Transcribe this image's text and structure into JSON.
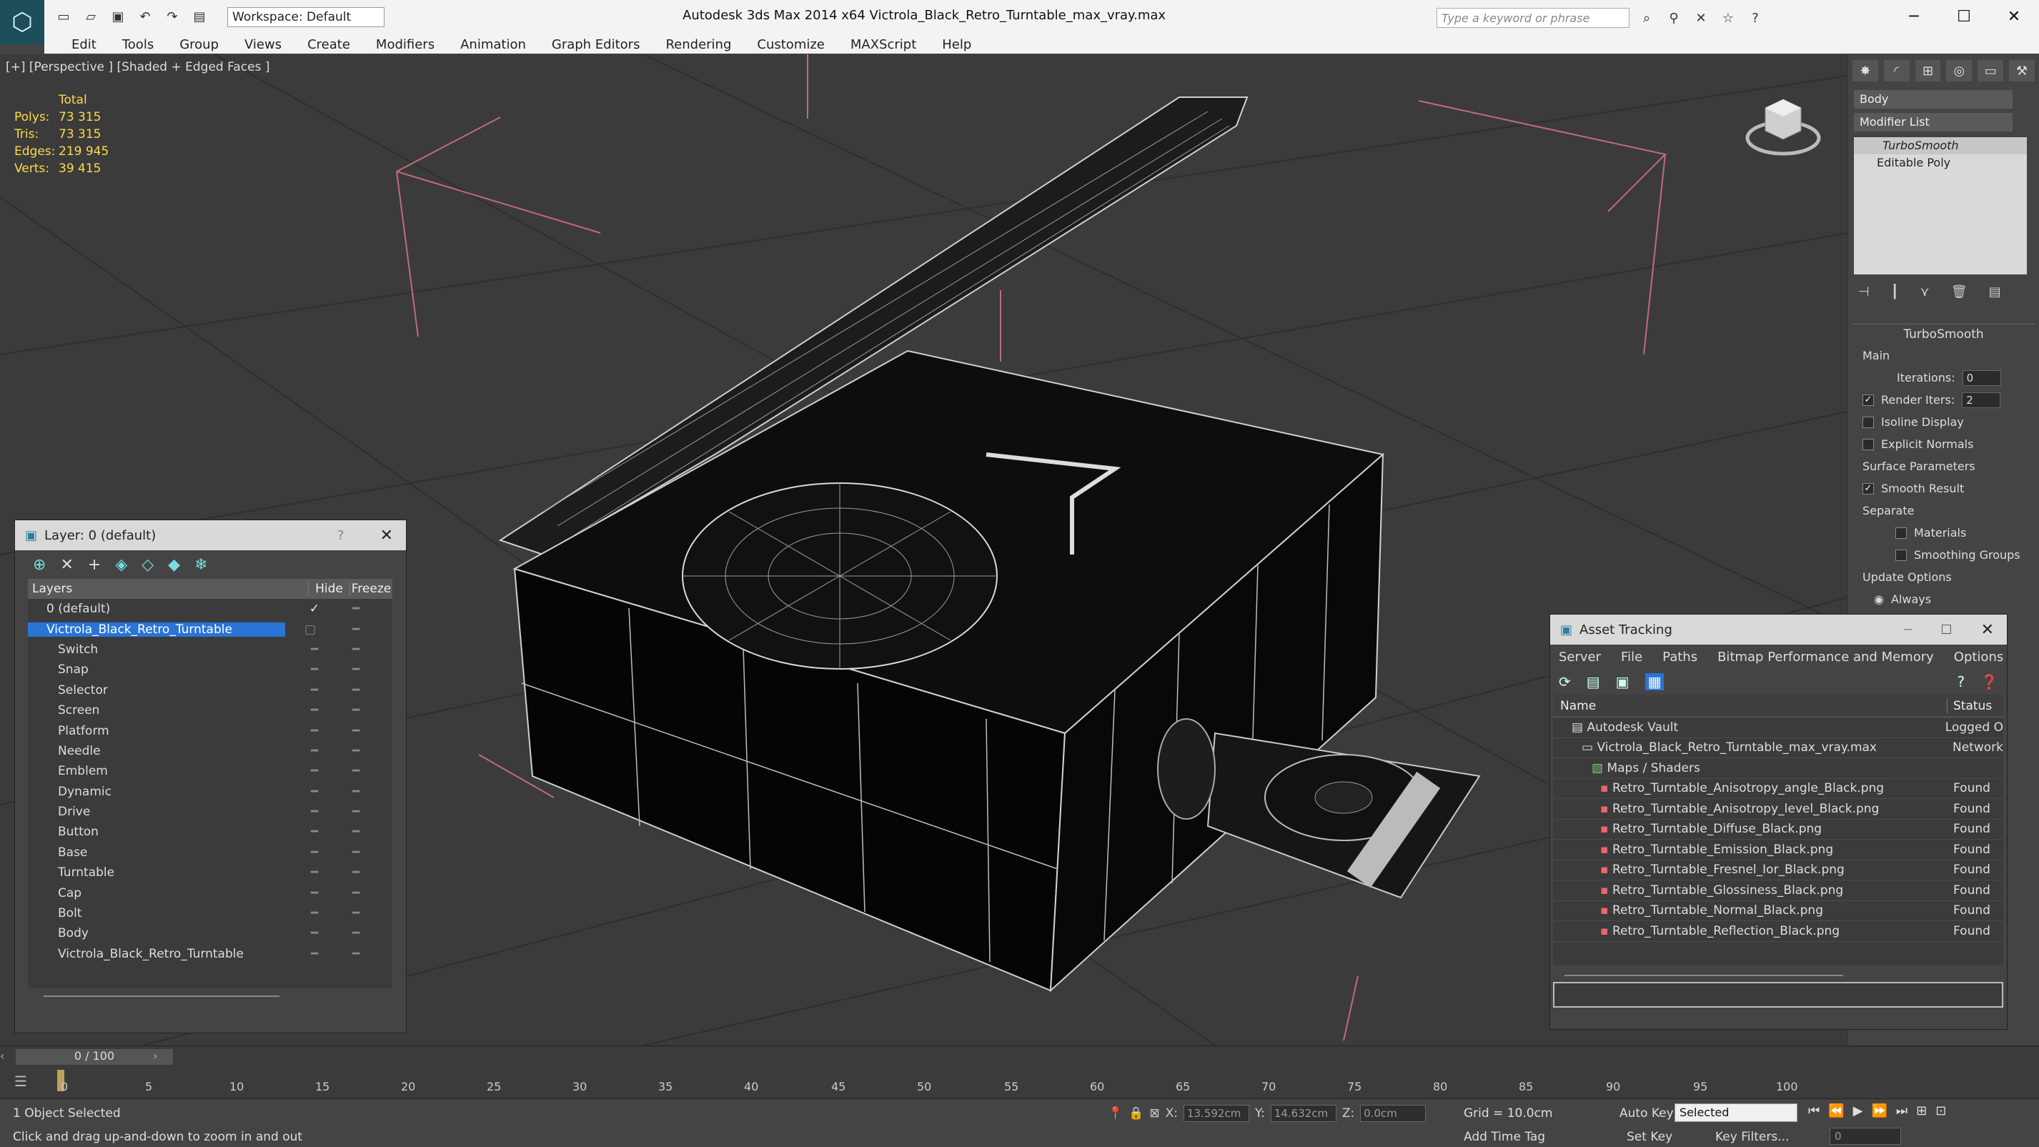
{
  "app": {
    "title": "Autodesk 3ds Max  2014 x64     Victrola_Black_Retro_Turntable_max_vray.max",
    "workspace": "Workspace: Default",
    "search_placeholder": "Type a keyword or phrase"
  },
  "menu": [
    "Edit",
    "Tools",
    "Group",
    "Views",
    "Create",
    "Modifiers",
    "Animation",
    "Graph Editors",
    "Rendering",
    "Customize",
    "MAXScript",
    "Help"
  ],
  "viewport": {
    "label": "[+] [Perspective ] [Shaded + Edged Faces ]",
    "stats": {
      "header": "Total",
      "rows": [
        {
          "label": "Polys:",
          "value": "73 315"
        },
        {
          "label": "Tris:",
          "value": "73 315"
        },
        {
          "label": "Edges:",
          "value": "219 945"
        },
        {
          "label": "Verts:",
          "value": "39 415"
        }
      ]
    }
  },
  "command_panel": {
    "object_name": "Body",
    "modifier_list": "Modifier List",
    "stack": [
      "TurboSmooth",
      "Editable Poly"
    ],
    "rollout_title": "TurboSmooth",
    "main_label": "Main",
    "iterations_label": "Iterations:",
    "iterations_value": "0",
    "render_iters_label": "Render Iters:",
    "render_iters_value": "2",
    "isoline": "Isoline Display",
    "explicit": "Explicit Normals",
    "surface_params": "Surface Parameters",
    "smooth_result": "Smooth Result",
    "separate": "Separate",
    "materials": "Materials",
    "smoothing_groups": "Smoothing Groups",
    "update_options": "Update Options",
    "always": "Always"
  },
  "layer_window": {
    "title": "Layer: 0 (default)",
    "help": "?",
    "col_layers": "Layers",
    "col_hide": "Hide",
    "col_freeze": "Freeze",
    "rows": [
      "0 (default)",
      "Victrola_Black_Retro_Turntable",
      "Switch",
      "Snap",
      "Selector",
      "Screen",
      "Platform",
      "Needle",
      "Emblem",
      "Dynamic",
      "Drive",
      "Button",
      "Base",
      "Turntable",
      "Cap",
      "Bolt",
      "Body",
      "Victrola_Black_Retro_Turntable"
    ]
  },
  "asset_window": {
    "title": "Asset Tracking",
    "menu": [
      "Server",
      "File",
      "Paths",
      "Bitmap Performance and Memory",
      "Options"
    ],
    "col_name": "Name",
    "col_status": "Status",
    "rows": [
      {
        "name": "Autodesk Vault",
        "status": "Logged O"
      },
      {
        "name": "Victrola_Black_Retro_Turntable_max_vray.max",
        "status": "Network"
      },
      {
        "name": "Maps / Shaders",
        "status": ""
      },
      {
        "name": "Retro_Turntable_Anisotropy_angle_Black.png",
        "status": "Found"
      },
      {
        "name": "Retro_Turntable_Anisotropy_level_Black.png",
        "status": "Found"
      },
      {
        "name": "Retro_Turntable_Diffuse_Black.png",
        "status": "Found"
      },
      {
        "name": "Retro_Turntable_Emission_Black.png",
        "status": "Found"
      },
      {
        "name": "Retro_Turntable_Fresnel_Ior_Black.png",
        "status": "Found"
      },
      {
        "name": "Retro_Turntable_Glossiness_Black.png",
        "status": "Found"
      },
      {
        "name": "Retro_Turntable_Normal_Black.png",
        "status": "Found"
      },
      {
        "name": "Retro_Turntable_Reflection_Black.png",
        "status": "Found"
      }
    ]
  },
  "timeline": {
    "slider": "0 / 100",
    "ticks": [
      "0",
      "5",
      "10",
      "15",
      "20",
      "25",
      "30",
      "35",
      "40",
      "45",
      "50",
      "55",
      "60",
      "65",
      "70",
      "75",
      "80",
      "85",
      "90",
      "95",
      "100"
    ]
  },
  "status": {
    "selection": "1 Object Selected",
    "prompt": "Click and drag up-and-down to zoom in and out",
    "x_label": "X:",
    "x_value": "13.592cm",
    "y_label": "Y:",
    "y_value": "14.632cm",
    "z_label": "Z:",
    "z_value": "0.0cm",
    "grid": "Grid = 10.0cm",
    "add_time_tag": "Add Time Tag",
    "auto_key": "Auto Key",
    "set_key": "Set Key",
    "selected": "Selected",
    "key_filters": "Key Filters...",
    "frame": "0"
  }
}
